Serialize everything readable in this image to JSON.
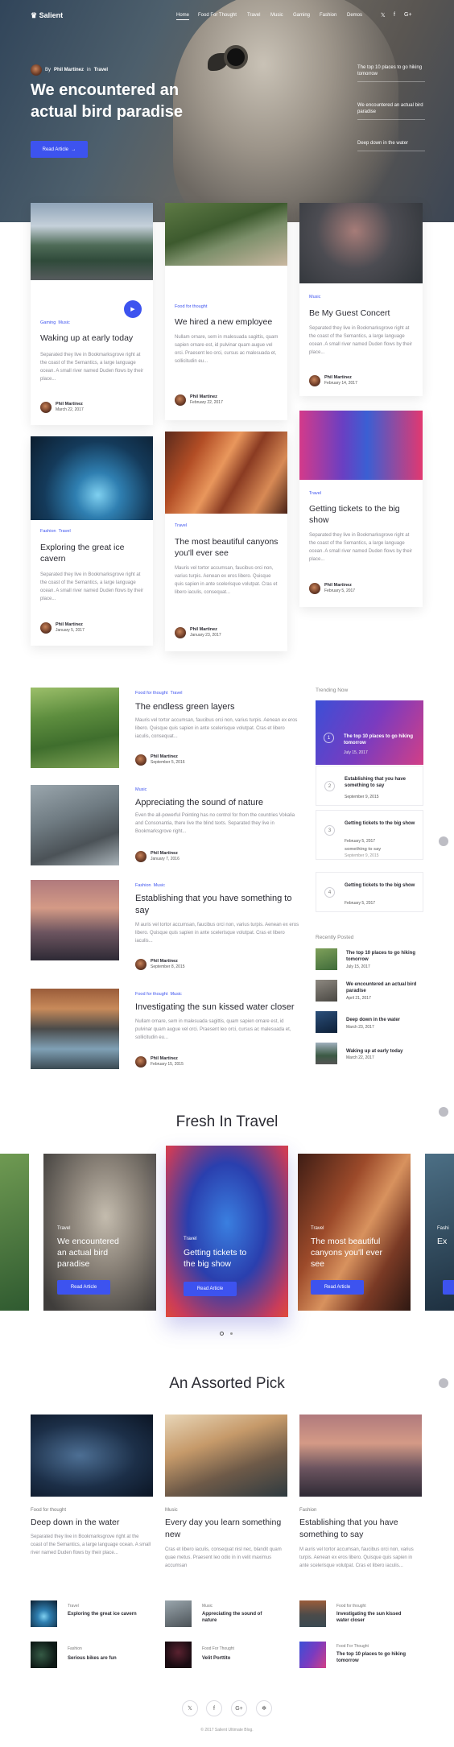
{
  "nav": {
    "logo": "Salient",
    "links": [
      "Home",
      "Food For Thought",
      "Travel",
      "Music",
      "Gaming",
      "Fashion",
      "Demos"
    ],
    "social": [
      "𝕏",
      "f",
      "G+"
    ]
  },
  "hero": {
    "by": "By",
    "author": "Phil Martinez",
    "in": "in",
    "category": "Travel",
    "title": "We encountered an actual bird paradise",
    "button": "Read Article",
    "side_items": [
      "The top 10 places to go hiking tomorrow",
      "We encountered an actual bird paradise",
      "Deep down in the water"
    ]
  },
  "cards": [
    {
      "tags": [
        "Gaming",
        "Music"
      ],
      "title": "Waking up at early today",
      "text": "Separated they live in Bookmarksgrove right at the coast of the Semantics, a large language ocean. A small river named Duden flows by their place...",
      "author": "Phil Martinez",
      "date": "March 22, 2017"
    },
    {
      "tags": [
        "Food for thought"
      ],
      "title": "We hired a new employee",
      "text": "Nullam ornare, sem in malesuada sagittis, quam sapien ornare est, id pulvinar quam augue vel orci. Praesent leo orci, cursus ac malesuada et, sollicitudin eu...",
      "author": "Phil Martinez",
      "date": "February 22, 2017"
    },
    {
      "tags": [
        "Music"
      ],
      "title": "Be My Guest Concert",
      "text": "Separated they live in Bookmarksgrove right at the coast of the Semantics, a large language ocean. A small river named Duden flows by their place...",
      "author": "Phil Martinez",
      "date": "February 14, 2017"
    },
    {
      "tags": [
        "Fashion",
        "Travel"
      ],
      "title": "Exploring the great ice cavern",
      "text": "Separated they live in Bookmarksgrove right at the coast of the Semantics, a large language ocean. A small river named Duden flows by their place...",
      "author": "Phil Martinez",
      "date": "January 5, 2017"
    },
    {
      "tags": [
        "Travel"
      ],
      "title": "The most beautiful canyons you'll ever see",
      "text": "Mauris vel tortor accumsan, faucibus orci non, varius turpis. Aenean ex eros libero. Quisque quis sapien in ante scelerisque volutpat. Cras et libero iaculis, consequat...",
      "author": "Phil Martinez",
      "date": "January 23, 2017"
    },
    {
      "tags": [
        "Travel"
      ],
      "title": "Getting tickets to the big show",
      "text": "Separated they live in Bookmarksgrove right at the coast of the Semantics, a large language ocean. A small river named Duden flows by their place...",
      "author": "Phil Martinez",
      "date": "February 5, 2017"
    }
  ],
  "list": [
    {
      "tags": [
        "Food for thought",
        "Travel"
      ],
      "title": "The endless green layers",
      "text": "Mauris vel tortor accumsan, faucibus orci non, varius turpis. Aenean ex eros libero. Quisque quis sapien in ante scelerisque volutpat. Cras et libero iaculis, consequat...",
      "author": "Phil Martinez",
      "date": "September 5, 2016"
    },
    {
      "tags": [
        "Music"
      ],
      "title": "Appreciating the sound of nature",
      "text": "Even the all-powerful Pointing has no control for from the countries Vokalia and Consonantia, there live the blind texts. Separated they live in Bookmarksgrove right...",
      "author": "Phil Martinez",
      "date": "January 7, 2016"
    },
    {
      "tags": [
        "Fashion",
        "Music"
      ],
      "title": "Establishing that you have something to say",
      "text": "M auris vel tortor accumsan, faucibus orci non, varius turpis. Aenean ex eros libero. Quisque quis sapien in ante scelerisque volutpat. Cras et libero iaculis...",
      "author": "Phil Martinez",
      "date": "September 8, 2015"
    },
    {
      "tags": [
        "Food for thought",
        "Music"
      ],
      "title": "Investigating the sun kissed water closer",
      "text": "Nullam ornare, sem in malesuada sagittis, quam sapien ornare est, id pulvinar quam augue vel orci. Praesent leo orci, cursus ac malesuada et, sollicitudin eu...",
      "author": "Phil Martinez",
      "date": "February 15, 2015"
    }
  ],
  "trending": {
    "heading": "Trending Now",
    "featured": {
      "num": "1",
      "title": "The top 10 places to go hiking tomorrow",
      "date": "July 15, 2017"
    },
    "items": [
      {
        "num": "2",
        "title": "Establishing that you have something to say",
        "date": "September 9, 2015"
      },
      {
        "num": "3",
        "title": "Getting tickets to the big show",
        "date": "February 5, 2017"
      },
      {
        "num": "4",
        "title": "Getting tickets to the big show",
        "date": "February 5, 2017"
      }
    ],
    "ghost_title": "something to say",
    "ghost_date": "September 9, 2015"
  },
  "recent": {
    "heading": "Recently Posted",
    "items": [
      {
        "title": "The top 10 places to go hiking tomorrow",
        "date": "July 15, 2017"
      },
      {
        "title": "We encountered an actual bird paradise",
        "date": "April 21, 2017"
      },
      {
        "title": "Deep down in the water",
        "date": "March 23, 2017"
      },
      {
        "title": "Waking up at early today",
        "date": "March 22, 2017"
      }
    ]
  },
  "fresh": {
    "heading": "Fresh In Travel",
    "slides": [
      {
        "tag": "Travel",
        "title": "We encountered an actual bird paradise",
        "button": "Read Article"
      },
      {
        "tag": "Travel",
        "title": "Getting tickets to the big show",
        "button": "Read Article"
      },
      {
        "tag": "Travel",
        "title": "The most beautiful canyons you'll ever see",
        "button": "Read Article"
      }
    ],
    "edge_tag": "Fashi",
    "edge_title": "Ex",
    "current_slide": 1,
    "slide_count": 2
  },
  "assorted": {
    "heading": "An Assorted Pick",
    "posts": [
      {
        "category": "Food for thought",
        "title": "Deep down in the water",
        "text": "Separated they live in Bookmarksgrove right at the coast of the Semantics, a large language ocean. A small river named Duden flows by their place..."
      },
      {
        "category": "Music",
        "title": "Every day you learn something new",
        "text": "Cras et libero iaculis, consequat nisl nec, blandit quam quae metus. Praesent leo odio in in velit maximus accumsan"
      },
      {
        "category": "Fashion",
        "title": "Establishing that you have something to say",
        "text": "M auris vel tortor accumsan, faucibus orci non, varius turpis. Aenean ex eros libero. Quisque quis sapien in ante scelerisque volutpat. Cras et libero iaculis..."
      }
    ],
    "small": [
      {
        "category": "Travel",
        "title": "Exploring the great ice cavern"
      },
      {
        "category": "Music",
        "title": "Appreciating the sound of nature"
      },
      {
        "category": "Food for thought",
        "title": "Investigating the sun kissed water closer"
      },
      {
        "category": "Fashion",
        "title": "Serious bikes are fun"
      },
      {
        "category": "Food For Thought",
        "title": "Velit Porttito"
      },
      {
        "category": "Food For Thought",
        "title": "The top 10 places to go hiking tomorrow"
      }
    ]
  },
  "footer": {
    "social": [
      "𝕏",
      "f",
      "G+",
      "✻"
    ],
    "copyright": "© 2017 Salient Ultimate Blog."
  },
  "colors": {
    "accent": "#3d53ef",
    "text": "#2b2b33",
    "muted": "#8c8c94"
  }
}
